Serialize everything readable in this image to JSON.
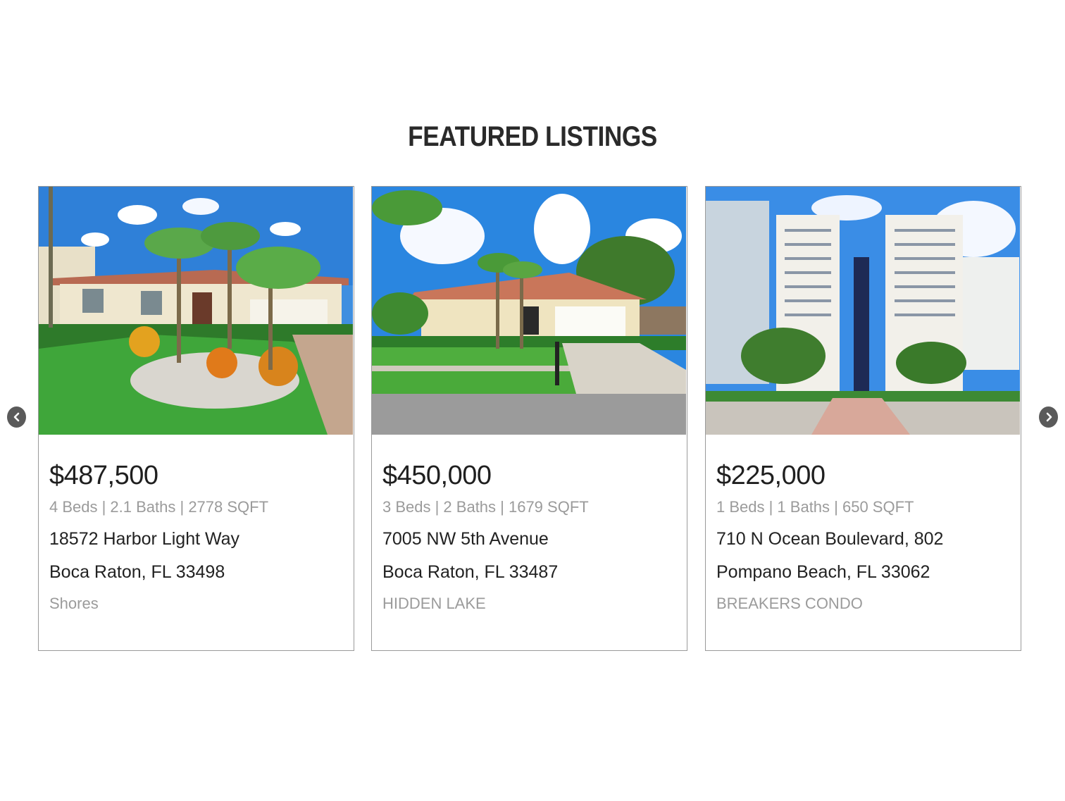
{
  "section": {
    "title": "FEATURED LISTINGS"
  },
  "carousel": {
    "prev_icon": "chevron-left-icon",
    "next_icon": "chevron-right-icon"
  },
  "listings": [
    {
      "price": "$487,500",
      "specs": "4 Beds | 2.1 Baths | 2778 SQFT",
      "street": "18572 Harbor Light Way",
      "city": "Boca Raton, FL 33498",
      "subdivision": "Shores",
      "photo": "house-with-palms-photo"
    },
    {
      "price": "$450,000",
      "specs": "3 Beds | 2 Baths | 1679 SQFT",
      "street": "7005 NW 5th Avenue",
      "city": "Boca Raton, FL 33487",
      "subdivision": "HIDDEN LAKE",
      "photo": "ranch-house-photo"
    },
    {
      "price": "$225,000",
      "specs": "1 Beds | 1 Baths | 650 SQFT",
      "street": "710 N Ocean Boulevard, 802",
      "city": "Pompano Beach, FL 33062",
      "subdivision": "BREAKERS CONDO",
      "photo": "condo-tower-photo"
    }
  ],
  "colors": {
    "border": "#9a9a9a",
    "muted_text": "#9b9b9b",
    "arrow": "#5a5a5a"
  }
}
